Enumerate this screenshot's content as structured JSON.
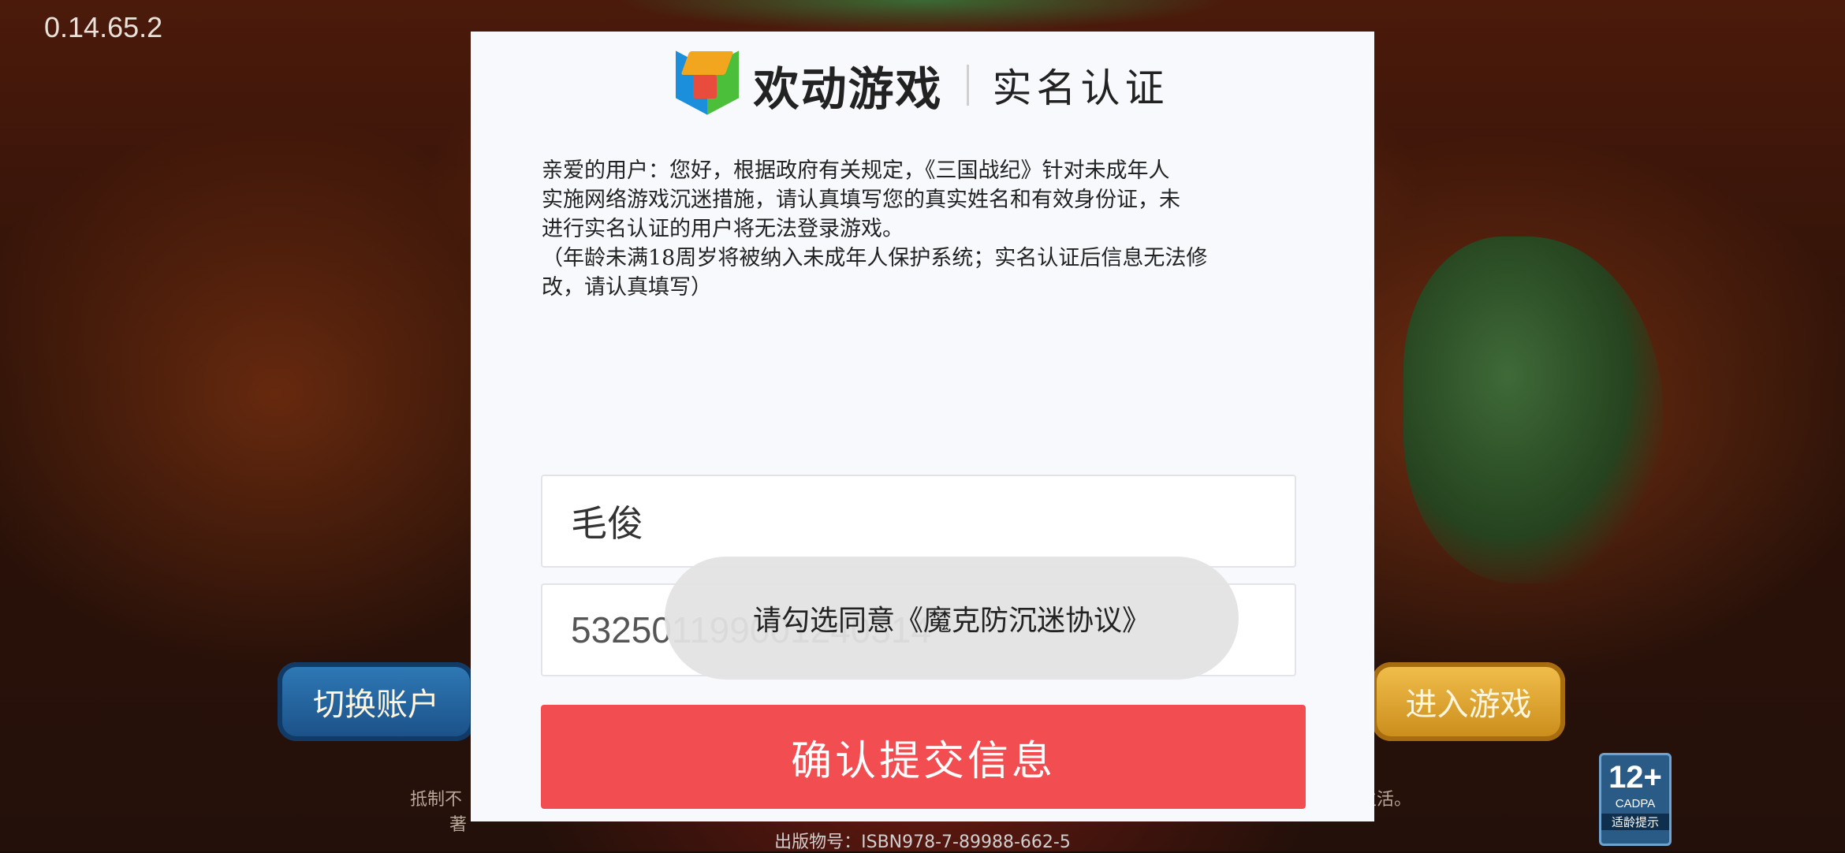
{
  "app": {
    "version": "0.14.65.2"
  },
  "background": {
    "switch_account": "切换账户",
    "enter_game": "进入游戏",
    "footer_line1_left": "抵制不",
    "footer_line1_right": "生活。",
    "footer_line2": "著",
    "footer_line3": "出版物号：ISBN978-7-89988-662-5",
    "age_rating": {
      "label": "12+",
      "org": "CADPA",
      "tip": "适龄提示"
    }
  },
  "dialog": {
    "brand": "欢动游戏",
    "title": "实名认证",
    "notice": "亲爱的用户：您好，根据政府有关规定，《三国战纪》针对未成年人\n实施网络游戏沉迷措施，请认真填写您的真实姓名和有效身份证，未\n进行实名认证的用户将无法登录游戏。\n（年龄未满18周岁将被纳入未成年人保护系统；实名认证后信息无法修\n改，请认真填写）",
    "name_value": "毛俊",
    "id_value": "532501199001240314",
    "submit_label": "确认提交信息"
  },
  "toast": {
    "message": "请勾选同意《魔克防沉迷协议》"
  },
  "colors": {
    "submit": "#f24e52",
    "dialog_bg": "#f7f9fd"
  }
}
